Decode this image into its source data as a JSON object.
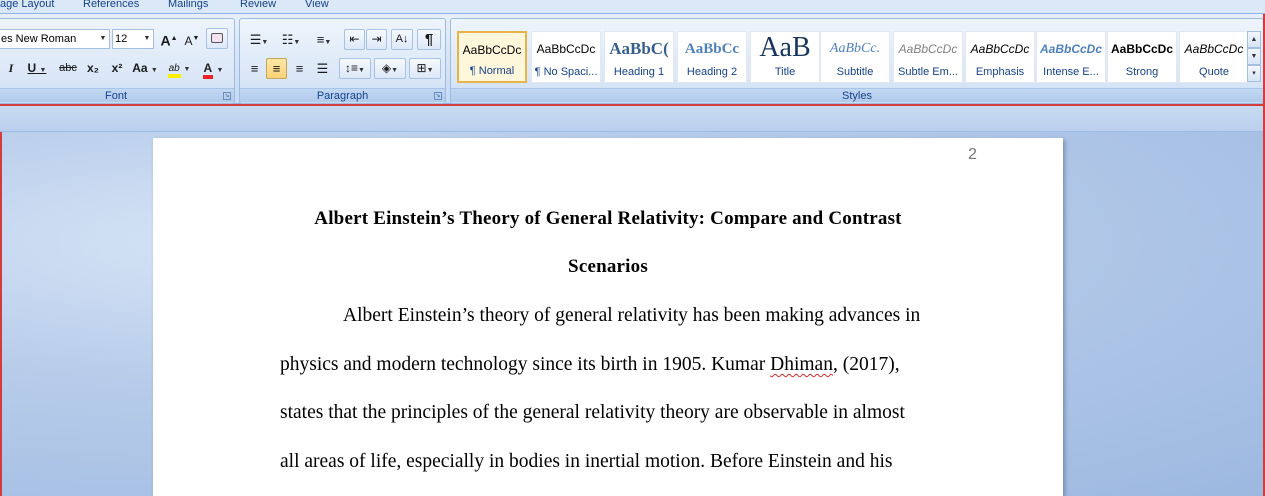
{
  "tabs": [
    "age Layout",
    "References",
    "Mailings",
    "Review",
    "View"
  ],
  "font_group": {
    "label": "Font",
    "font_name": "es New Roman",
    "font_size": "12",
    "grow_font": "A",
    "shrink_font": "A",
    "italic": "I",
    "underline": "U",
    "strikethrough": "abc",
    "subscript": "x₂",
    "superscript": "x²",
    "change_case": "Aa",
    "highlight": "ab",
    "font_color": "A"
  },
  "paragraph_group": {
    "label": "Paragraph",
    "show_hide": "¶"
  },
  "styles_group": {
    "label": "Styles",
    "items": [
      {
        "preview": "AaBbCcDc",
        "name": "¶ Normal"
      },
      {
        "preview": "AaBbCcDc",
        "name": "¶ No Spaci..."
      },
      {
        "preview": "AaBbC(",
        "name": "Heading 1"
      },
      {
        "preview": "AaBbCc",
        "name": "Heading 2"
      },
      {
        "preview": "AaB",
        "name": "Title"
      },
      {
        "preview": "AaBbCc.",
        "name": "Subtitle"
      },
      {
        "preview": "AaBbCcDc",
        "name": "Subtle Em..."
      },
      {
        "preview": "AaBbCcDc",
        "name": "Emphasis"
      },
      {
        "preview": "AaBbCcDc",
        "name": "Intense E..."
      },
      {
        "preview": "AaBbCcDc",
        "name": "Strong"
      },
      {
        "preview": "AaBbCcDc",
        "name": "Quote"
      }
    ]
  },
  "document": {
    "page_number": "2",
    "title_line1": "Albert Einstein’s Theory of General Relativity: Compare and Contrast",
    "title_line2": "Scenarios",
    "line1": "Albert Einstein’s theory of general relativity has been making advances in",
    "line2_a": "physics and modern technology since its birth in 1905. Kumar ",
    "line2_b": "Dhiman",
    "line2_c": ", (2017),",
    "line3": "states that the principles of the general relativity theory are observable in almost",
    "line4": "all areas of life, especially in bodies in inertial motion. Before Einstein and his"
  }
}
